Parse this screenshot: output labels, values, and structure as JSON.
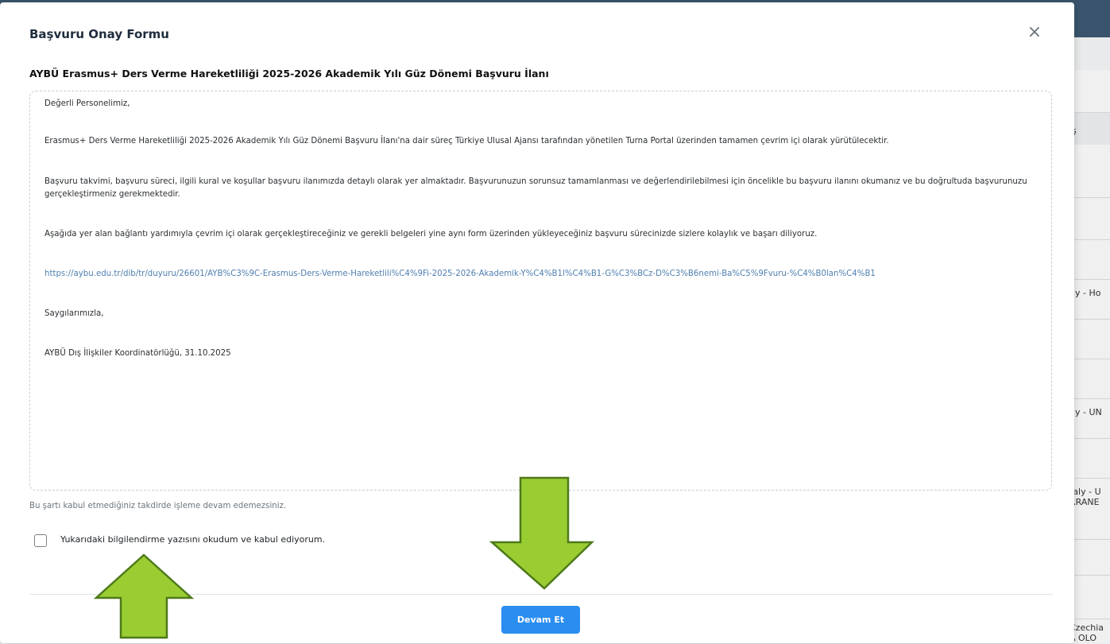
{
  "background": {
    "table_rows": [
      "ış",
      "ny - Ho",
      "ny - UN",
      "taly - U\nRRANE",
      "Czechia\nA OLO"
    ]
  },
  "modal": {
    "title": "Başvuru Onay Formu",
    "close_glyph": "×",
    "subtitle": "AYBÜ Erasmus+ Ders Verme Hareketliliği 2025-2026 Akademik Yılı Güz Dönemi Başvuru İlanı",
    "content": {
      "greeting": "Değerli Personelimiz,",
      "paragraph1": "Erasmus+ Ders Verme Hareketliliği 2025-2026 Akademik Yılı Güz Dönemi Başvuru İlanı'na dair süreç Türkiye Ulusal Ajansı tarafından yönetilen Turna Portal üzerinden tamamen çevrim içi olarak yürütülecektir.",
      "paragraph2": "Başvuru takvimi, başvuru süreci, ilgili kural ve koşullar başvuru ilanımızda detaylı olarak yer almaktadır. Başvurunuzun sorunsuz tamamlanması ve değerlendirilebilmesi için öncelikle bu başvuru ilanını okumanız ve bu doğrultuda başvurunuzu gerçekleştirmeniz gerekmektedir.",
      "paragraph3": "Aşağıda yer alan bağlantı yardımıyla çevrim içi olarak gerçekleştireceğiniz ve gerekli belgeleri yine aynı form üzerinden yükleyeceğiniz başvuru sürecinizde sizlere kolaylık ve başarı diliyoruz.",
      "link": "https://aybu.edu.tr/dib/tr/duyuru/26601/AYB%C3%9C-Erasmus-Ders-Verme-Hareketlili%C4%9Fi-2025-2026-Akademik-Y%C4%B1l%C4%B1-G%C3%BCz-D%C3%B6nemi-Ba%C5%9Fvuru-%C4%B0lan%C4%B1",
      "closing": "Saygılarımızla,",
      "signature": "AYBÜ Dış İlişkiler Koordinatörlüğü, 31.10.2025"
    },
    "warning": "Bu şartı kabul etmediğiniz takdirde işleme devam edemezsiniz.",
    "checkbox_label": "Yukarıdaki bilgilendirme yazısını okudum ve kabul ediyorum.",
    "checkbox_checked": false,
    "continue_button": "Devam Et"
  },
  "colors": {
    "primary": "#2a8df0",
    "link": "#4f7fb0",
    "arrow_fill": "#9acd32",
    "arrow_stroke": "#4e7a1a"
  }
}
